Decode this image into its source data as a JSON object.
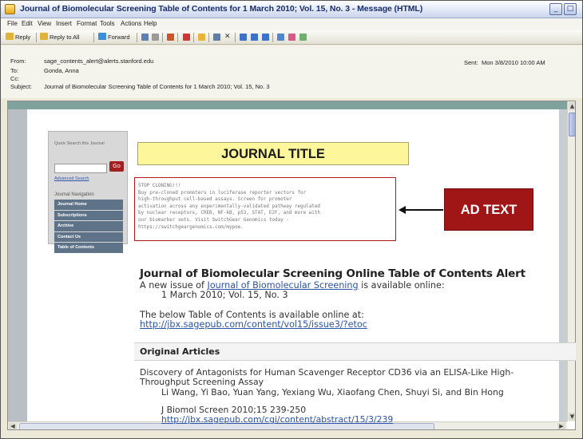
{
  "window": {
    "title": "Journal of Biomolecular Screening Table of Contents for 1 March 2010; Vol. 15, No. 3 - Message (HTML)"
  },
  "menu": [
    "File",
    "Edit",
    "View",
    "Insert",
    "Format",
    "Tools",
    "Actions",
    "Help"
  ],
  "toolbar": {
    "reply": "Reply",
    "reply_all": "Reply to All",
    "forward": "Forward"
  },
  "header": {
    "from_label": "From:",
    "from_value": "sage_contents_alert@alerts.stanford.edu",
    "to_label": "To:",
    "to_value": "Gonda, Anna",
    "cc_label": "Cc:",
    "subject_label": "Subject:",
    "subject_value": "Journal of Biomolecular Screening Table of Contents for 1 March 2010; Vol. 15, No. 3",
    "sent_label": "Sent:",
    "sent_value": "Mon 3/8/2010 10:00 AM"
  },
  "sidebar": {
    "quick_search_label": "Quick Search this Journal",
    "go_label": "Go",
    "advanced_search": "Advanced Search",
    "nav_label": "Journal Navigation",
    "items": [
      "Journal Home",
      "Subscriptions",
      "Archive",
      "Contact Us",
      "Table of Contents"
    ]
  },
  "journal_title_placeholder": "JOURNAL TITLE",
  "ad": {
    "label": "AD TEXT",
    "text": "STOP CLONING!!!\nBuy pre-cloned promoters in luciferase reporter vectors for\nhigh-throughput cell-based assays. Screen for promoter\nactivation across any experimentally-validated pathway regulated\nby nuclear receptors, CREB, NF-kB, p53, STAT, E2F, and more with\nour biomarker sets. Visit SwitchGear Genomics today -\nhttps://switchgeargenomics.com/mypoe."
  },
  "alert": {
    "heading": "Journal of Biomolecular Screening Online Table of Contents Alert",
    "line1_prefix": "A new issue of ",
    "line1_link": "Journal of Biomolecular Screening",
    "line1_suffix": " is available online:",
    "line2": "1 March 2010; Vol. 15, No. 3",
    "line3": "The below Table of Contents is available online at:",
    "toc_url": "http://jbx.sagepub.com/content/vol15/issue3/?etoc"
  },
  "section_title": "Original Articles",
  "article": {
    "title_line1": "Discovery of Antagonists for Human Scavenger Receptor CD36 via an ELISA-Like High-",
    "title_line2": "Throughput Screening Assay",
    "authors": "Li Wang, Yi Bao, Yuan Yang, Yexiang Wu, Xiaofang Chen, Shuyi Si, and Bin Hong",
    "citation": "J Biomol Screen 2010;15 239-250",
    "url": "http://jbx.sagepub.com/cgi/content/abstract/15/3/239"
  }
}
